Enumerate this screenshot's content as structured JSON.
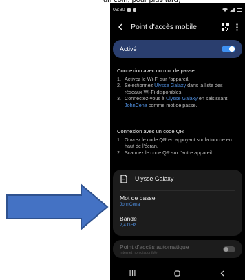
{
  "caption": "un coin, pour plus tard)",
  "statusbar": {
    "time": "09:30"
  },
  "header": {
    "title": "Point d'accès mobile"
  },
  "active_toggle": {
    "label": "Activé",
    "state": "on"
  },
  "password_section": {
    "heading": "Connexion avec un mot de passe",
    "steps": [
      {
        "num": "1.",
        "text": [
          {
            "t": "Activez le Wi-Fi sur l'appareil."
          }
        ]
      },
      {
        "num": "2.",
        "text": [
          {
            "t": "Sélectionnez "
          },
          {
            "t": "Ulysse Galaxy",
            "link": true
          },
          {
            "t": " dans la liste des réseaux Wi-Fi disponibles."
          }
        ]
      },
      {
        "num": "3.",
        "text": [
          {
            "t": "Connectez-vous à "
          },
          {
            "t": "Ulysse Galaxy",
            "link": true
          },
          {
            "t": " en saisissant "
          },
          {
            "t": "JohnCena",
            "link": true
          },
          {
            "t": " comme mot de passe."
          }
        ]
      }
    ]
  },
  "qr_section": {
    "heading": "Connexion avec un code QR",
    "steps": [
      {
        "num": "1.",
        "text": [
          {
            "t": "Ouvrez le code QR en appuyant sur la touche en haut de l'écran."
          }
        ]
      },
      {
        "num": "2.",
        "text": [
          {
            "t": "Scannez le code QR sur l'autre appareil."
          }
        ]
      }
    ]
  },
  "network_card": {
    "name": "Ulysse Galaxy",
    "password_label": "Mot de passe",
    "password_value": "JohnCena",
    "band_label": "Bande",
    "band_value": "2,4 GHz"
  },
  "auto_hotspot": {
    "label": "Point d'accès automatique",
    "sub": "Internet non disponible",
    "state": "off"
  },
  "colors": {
    "accent": "#3e91f2",
    "link": "#4f8fe0",
    "arrow_fill": "#4472c4",
    "arrow_stroke": "#2f528f",
    "active_row_bg": "#2a3e6e",
    "screen_bg": "#000000"
  },
  "icons": [
    "back-icon",
    "qr-code-icon",
    "more-options-icon",
    "network-document-icon",
    "recent-apps-icon",
    "home-icon",
    "back-nav-icon"
  ]
}
